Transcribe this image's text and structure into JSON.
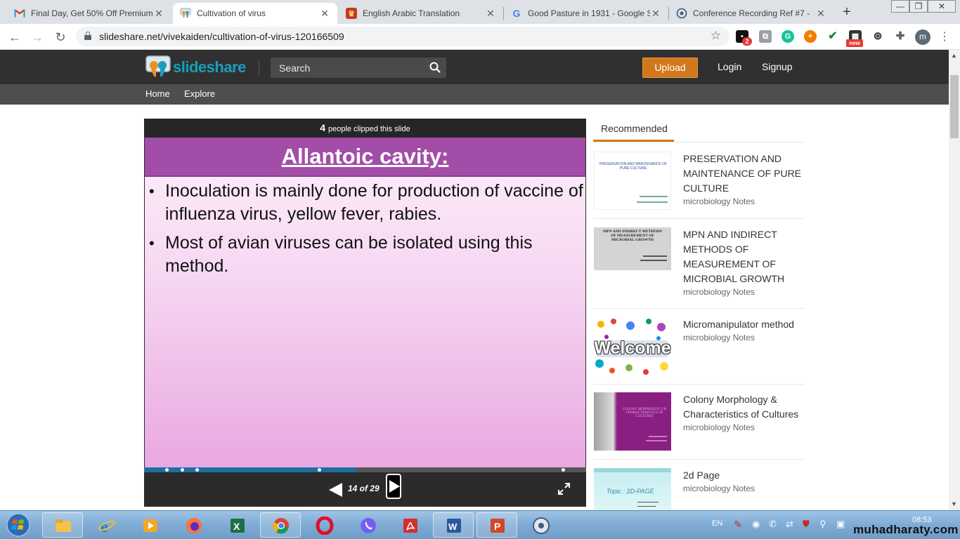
{
  "browser": {
    "tabs": [
      {
        "title": "Final Day, Get 50% Off Premium",
        "favicon": "gmail-icon",
        "active": false
      },
      {
        "title": "Cultivation of virus",
        "favicon": "slideshare-icon",
        "active": true
      },
      {
        "title": "English Arabic Translation",
        "favicon": "translation-icon",
        "active": false
      },
      {
        "title": "Good Pasture in 1931 - Google S",
        "favicon": "google-icon",
        "active": false
      },
      {
        "title": "Conference Recording Ref #7 - ",
        "favicon": "conference-icon",
        "active": false
      }
    ],
    "new_tab_label": "+",
    "url": "slideshare.net/vivekaiden/cultivation-of-virus-120166509",
    "extensions": {
      "badge_count": "2",
      "new_badge": "new"
    },
    "profile_initial": "m"
  },
  "header": {
    "logo_word_a": "slide",
    "logo_word_b": "share",
    "search_placeholder": "Search",
    "upload_label": "Upload",
    "login_label": "Login",
    "signup_label": "Signup"
  },
  "subnav": {
    "home_label": "Home",
    "explore_label": "Explore"
  },
  "player": {
    "clip_count": "4",
    "clip_text": "people clipped this slide",
    "slide_title": "Allantoic cavity:",
    "bullets": [
      "Inoculation is mainly done for production of vaccine of influenza virus, yellow fever, rabies.",
      "Most of avian viruses can be isolated using this method."
    ],
    "page_label": "14 of 29",
    "current_page": 14,
    "total_pages": 29,
    "progress_fraction": 0.48
  },
  "recommended": {
    "tab_label": "Recommended",
    "items": [
      {
        "title": "PRESERVATION AND MAINTENANCE OF PURE CULTURE",
        "author": "microbiology Notes",
        "thumb_text": "PRESERVATION AND MAINTENANCE OF PURE CULTURE"
      },
      {
        "title": "MPN AND INDIRECT METHODS OF MEASUREMENT OF MICROBIAL GROWTH",
        "author": "microbiology Notes",
        "thumb_text": "MPN AND INDIRECT METHODS OF MEASUREMENT OF MICROBIAL GROWTH"
      },
      {
        "title": "Micromanipulator method",
        "author": "microbiology Notes",
        "thumb_text": "Welcome"
      },
      {
        "title": "Colony Morphology & Characteristics of Cultures",
        "author": "microbiology Notes",
        "thumb_text": "COLONY MORPHOLOGY & CHARACTERISTICS OF CULTURES"
      },
      {
        "title": "2d Page",
        "author": "microbiology Notes",
        "thumb_text": "Topic : 2D-PAGE"
      }
    ]
  },
  "taskbar": {
    "language": "EN",
    "time": "08:53",
    "watermark": "muhadharaty.com"
  },
  "colors": {
    "accent_orange": "#d1781c",
    "header_dark": "#303030",
    "slide_title_purple": "#a24da8",
    "slideshare_teal": "#0fa2b6"
  }
}
